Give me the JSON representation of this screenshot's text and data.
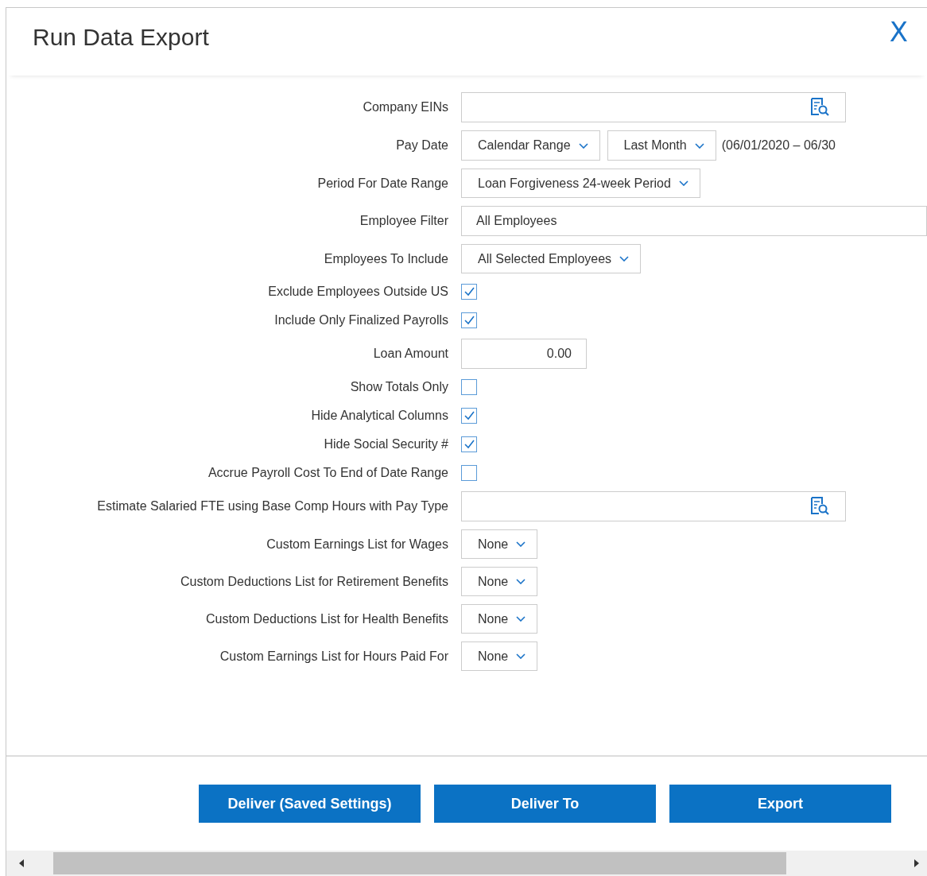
{
  "dialog": {
    "title": "Run Data Export",
    "close": "X"
  },
  "rows": [
    {
      "kind": "lookup",
      "label": "Company EINs"
    },
    {
      "kind": "date_range",
      "label": "Pay Date",
      "selects": [
        "Calendar Range",
        "Last Month"
      ],
      "range": "(06/01/2020 – 06/30"
    },
    {
      "kind": "select",
      "label": "Period For Date Range",
      "value": "Loan Forgiveness 24-week Period"
    },
    {
      "kind": "text",
      "label": "Employee Filter",
      "value": "All Employees"
    },
    {
      "kind": "select",
      "label": "Employees To Include",
      "value": "All Selected Employees"
    },
    {
      "kind": "checkbox",
      "label": "Exclude Employees Outside US",
      "checked": true
    },
    {
      "kind": "checkbox",
      "label": "Include Only Finalized Payrolls",
      "checked": true
    },
    {
      "kind": "number",
      "label": "Loan Amount",
      "value": "0.00"
    },
    {
      "kind": "checkbox",
      "label": "Show Totals Only",
      "checked": false
    },
    {
      "kind": "checkbox",
      "label": "Hide Analytical Columns",
      "checked": true
    },
    {
      "kind": "checkbox",
      "label": "Hide Social Security #",
      "checked": true
    },
    {
      "kind": "checkbox",
      "label": "Accrue Payroll Cost To End of Date Range",
      "checked": false
    },
    {
      "kind": "lookup",
      "label": "Estimate Salaried FTE using Base Comp Hours with Pay Type"
    },
    {
      "kind": "select",
      "label": "Custom Earnings List for Wages",
      "value": "None"
    },
    {
      "kind": "select",
      "label": "Custom Deductions List for Retirement Benefits",
      "value": "None"
    },
    {
      "kind": "select",
      "label": "Custom Deductions List for Health Benefits",
      "value": "None"
    },
    {
      "kind": "select",
      "label": "Custom Earnings List for Hours Paid For",
      "value": "None"
    }
  ],
  "buttons": [
    "Deliver (Saved Settings)",
    "Deliver To",
    "Export"
  ]
}
